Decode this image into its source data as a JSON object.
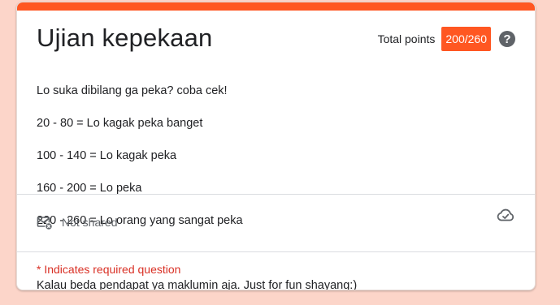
{
  "form": {
    "title": "Ujian kepekaan",
    "total_points_label": "Total points",
    "score": "200/260",
    "help_icon_glyph": "?",
    "description_lines": [
      "Lo suka dibilang ga peka? coba cek!",
      "20 - 80 = Lo kagak peka banget",
      "100 - 140 = Lo kagak peka",
      "160 - 200 = Lo peka",
      "220 - 260 = Lo orang yang sangat peka",
      "",
      "Kalau beda pendapat ya maklumin aja. Just for fun shayang:)"
    ],
    "share_status": "Not shared",
    "required_note": "* Indicates required question"
  },
  "icons": {
    "help": "help-circle-icon",
    "mail": "mail-not-shared-icon",
    "cloud": "cloud-saved-icon"
  },
  "colors": {
    "accent": "#ff5722",
    "background": "#fcd5c9",
    "required_text": "#d93025"
  }
}
